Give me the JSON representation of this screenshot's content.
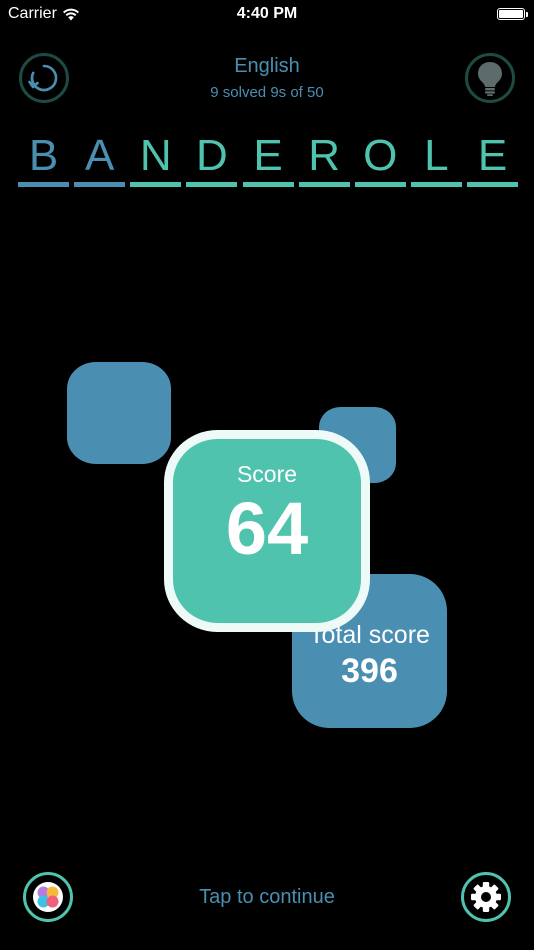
{
  "status_bar": {
    "carrier": "Carrier",
    "time": "4:40 PM"
  },
  "header": {
    "language": "English",
    "progress": "9 solved 9s of 50"
  },
  "word": {
    "letters": [
      {
        "char": "B",
        "solved": true
      },
      {
        "char": "A",
        "solved": true
      },
      {
        "char": "N",
        "solved": false
      },
      {
        "char": "D",
        "solved": false
      },
      {
        "char": "E",
        "solved": false
      },
      {
        "char": "R",
        "solved": false
      },
      {
        "char": "O",
        "solved": false
      },
      {
        "char": "L",
        "solved": false
      },
      {
        "char": "E",
        "solved": false
      }
    ]
  },
  "score": {
    "label": "Score",
    "value": "64"
  },
  "total_score": {
    "label": "Total score",
    "value": "396"
  },
  "footer": {
    "tap_continue": "Tap to continue"
  },
  "icons": {
    "refresh": "refresh-icon",
    "hint": "lightbulb-icon",
    "gamecenter": "game-center-icon",
    "settings": "gear-icon"
  },
  "colors": {
    "teal": "#4fc3ad",
    "blue": "#4a8fb2",
    "dark_ring": "#1e4a44",
    "background": "#000000"
  }
}
